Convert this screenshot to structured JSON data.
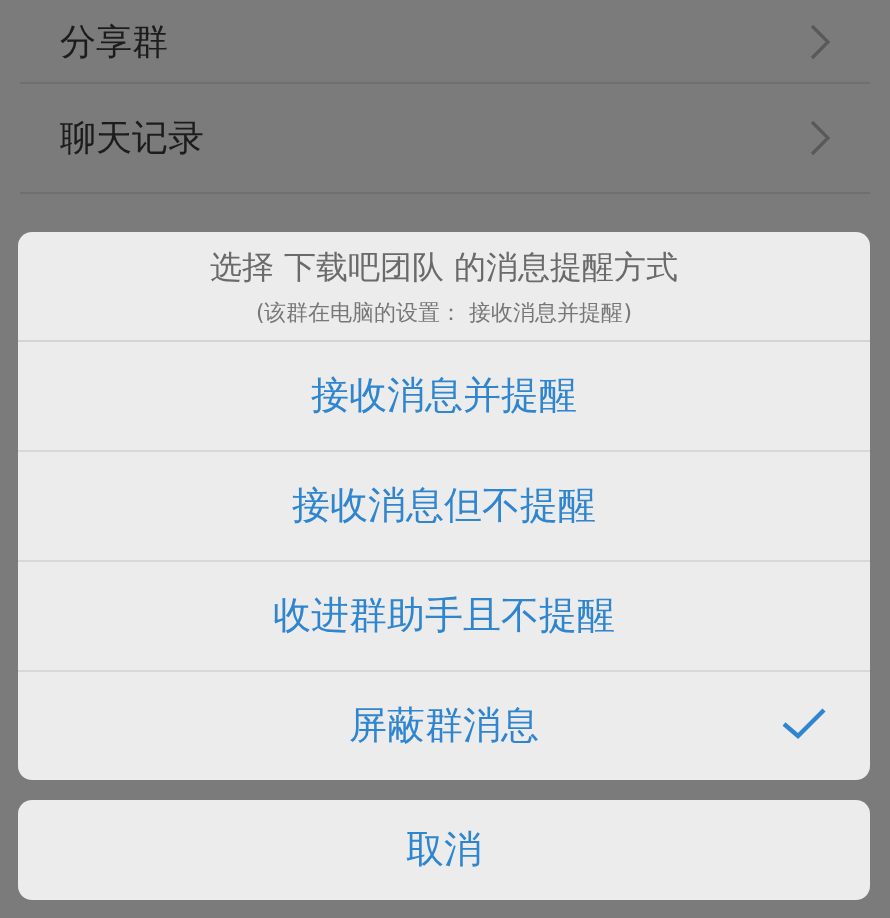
{
  "settings_list": [
    {
      "label": "分享群"
    },
    {
      "label": "聊天记录"
    }
  ],
  "dialog": {
    "title": "选择 下载吧团队 的消息提醒方式",
    "subtitle": "(该群在电脑的设置： 接收消息并提醒)",
    "options": [
      {
        "label": "接收消息并提醒",
        "selected": false
      },
      {
        "label": "接收消息但不提醒",
        "selected": false
      },
      {
        "label": "收进群助手且不提醒",
        "selected": false
      },
      {
        "label": "屏蔽群消息",
        "selected": true
      }
    ],
    "cancel": "取消"
  }
}
